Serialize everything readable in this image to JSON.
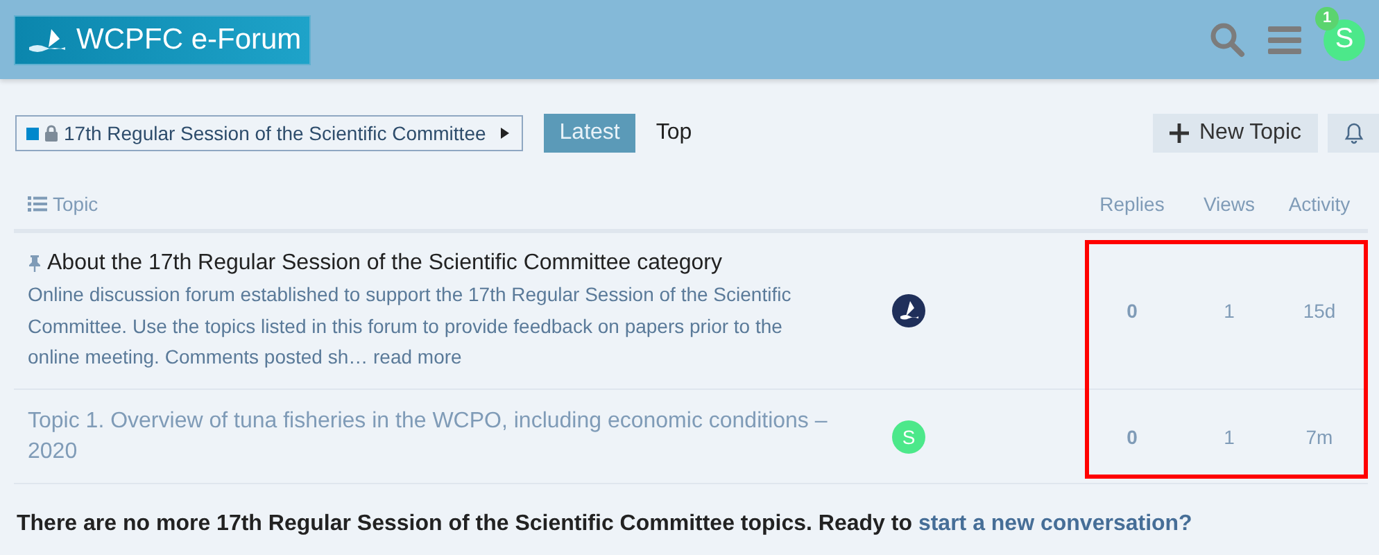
{
  "header": {
    "logo_text": "WCPFC e-Forum",
    "notification_count": "1",
    "avatar_letter": "S"
  },
  "nav": {
    "category": {
      "name": "17th Regular Session of the Scientific Committee",
      "color": "#0088cc",
      "locked": true
    },
    "tabs": [
      {
        "label": "Latest",
        "selected": true
      },
      {
        "label": "Top",
        "selected": false
      }
    ],
    "new_topic": "New Topic"
  },
  "table": {
    "columns": [
      "Topic",
      "Replies",
      "Views",
      "Activity"
    ],
    "highlight_box": true,
    "rows": [
      {
        "title": "About the 17th Regular Session of the Scientific Committee category",
        "pinned": true,
        "visited": false,
        "excerpt": "Online discussion forum established to support the 17th Regular Session of the Scientific Committee. Use the topics listed in this forum to provide feedback on papers prior to the online meeting. Comments posted sh…",
        "read_more": "read more",
        "poster": {
          "kind": "logo"
        },
        "replies": "0",
        "views": "1",
        "activity": "15d"
      },
      {
        "title": "Topic 1. Overview of tuna fisheries in the WCPO, including economic conditions – 2020",
        "pinned": false,
        "visited": true,
        "poster": {
          "kind": "letter",
          "letter": "S"
        },
        "replies": "0",
        "views": "1",
        "activity": "7m"
      }
    ]
  },
  "footer": {
    "text": "There are no more 17th Regular Session of the Scientific Committee topics. Ready to",
    "link": "start a new conversation?"
  }
}
